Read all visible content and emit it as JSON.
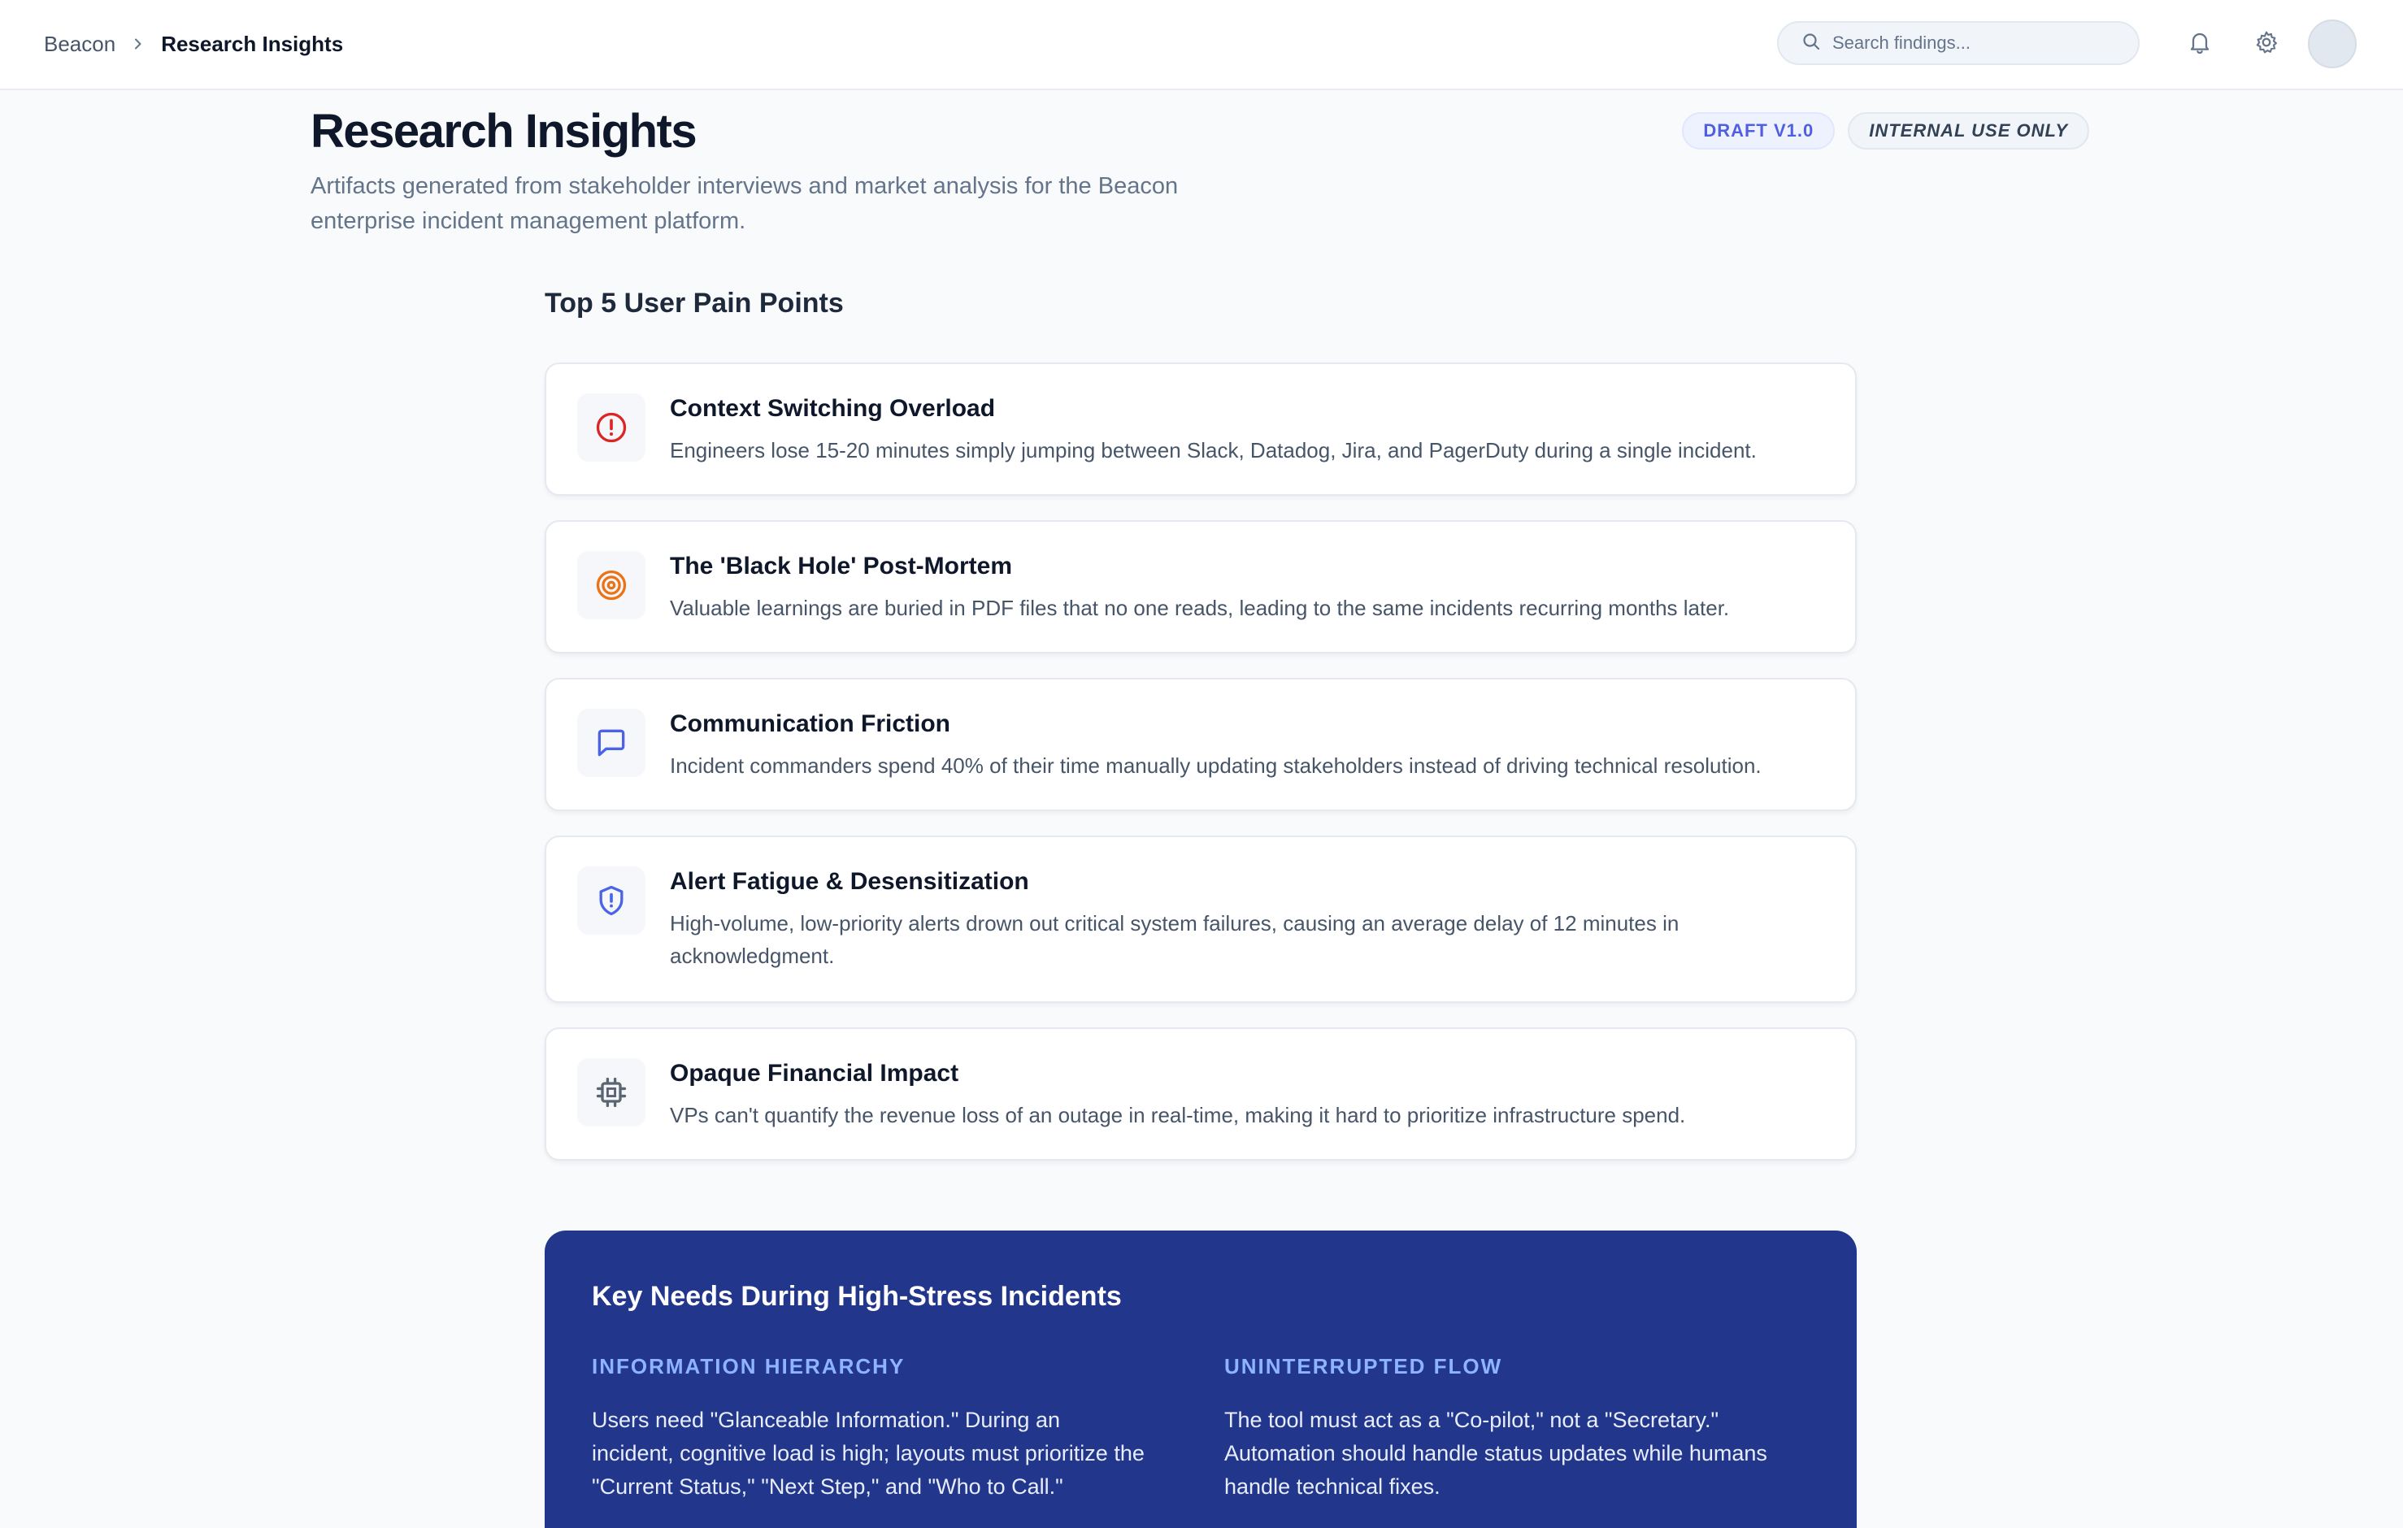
{
  "breadcrumb": {
    "root": "Beacon",
    "current": "Research Insights"
  },
  "search": {
    "placeholder": "Search findings..."
  },
  "header": {
    "title": "Research Insights",
    "subtitle": "Artifacts generated from stakeholder interviews and market analysis for the Beacon enterprise incident management platform.",
    "badges": {
      "draft": "DRAFT V1.0",
      "internal": "INTERNAL USE ONLY"
    }
  },
  "pain_points": {
    "title": "Top 5 User Pain Points",
    "items": [
      {
        "title": "Context Switching Overload",
        "description": "Engineers lose 15-20 minutes simply jumping between Slack, Datadog, Jira, and PagerDuty during a single incident.",
        "icon": "alert-circle-icon",
        "color": "#dc2626"
      },
      {
        "title": "The 'Black Hole' Post-Mortem",
        "description": "Valuable learnings are buried in PDF files that no one reads, leading to the same incidents recurring months later.",
        "icon": "target-icon",
        "color": "#ea7317"
      },
      {
        "title": "Communication Friction",
        "description": "Incident commanders spend 40% of their time manually updating stakeholders instead of driving technical resolution.",
        "icon": "message-square-icon",
        "color": "#4a63e7"
      },
      {
        "title": "Alert Fatigue & Desensitization",
        "description": "High-volume, low-priority alerts drown out critical system failures, causing an average delay of 12 minutes in acknowledgment.",
        "icon": "shield-alert-icon",
        "color": "#4a63e7"
      },
      {
        "title": "Opaque Financial Impact",
        "description": "VPs can't quantify the revenue loss of an outage in real-time, making it hard to prioritize infrastructure spend.",
        "icon": "cpu-icon",
        "color": "#5b6474"
      }
    ]
  },
  "key_needs": {
    "title": "Key Needs During High-Stress Incidents",
    "items": [
      {
        "heading": "INFORMATION HIERARCHY",
        "body": "Users need \"Glanceable Information.\" During an incident, cognitive load is high; layouts must prioritize the \"Current Status,\" \"Next Step,\" and \"Who to Call.\""
      },
      {
        "heading": "UNINTERRUPTED FLOW",
        "body": "The tool must act as a \"Co-pilot,\" not a \"Secretary.\" Automation should handle status updates while humans handle technical fixes."
      }
    ]
  },
  "colors": {
    "accent": "#4f5fdf",
    "panel": "#22378c",
    "panel_heading": "#8fb4ff"
  }
}
